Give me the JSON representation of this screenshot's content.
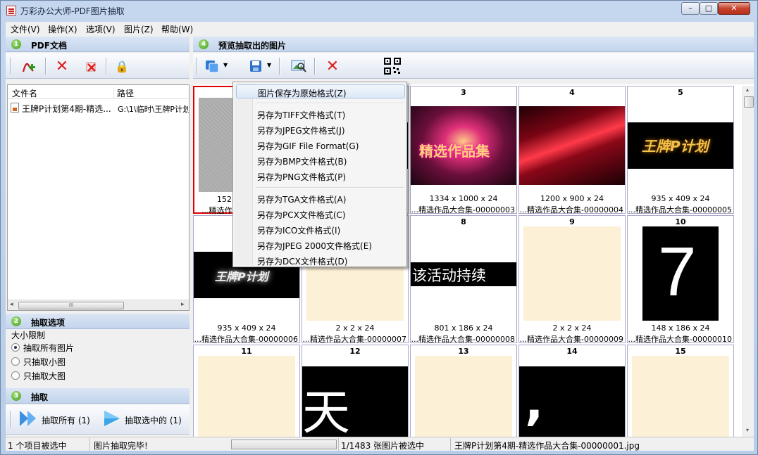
{
  "window": {
    "title": "万彩办公大师-PDF图片抽取",
    "min": "–",
    "max": "□",
    "close": "✕"
  },
  "menu": [
    "文件(V)",
    "操作(X)",
    "选项(V)",
    "图片(Z)",
    "帮助(W)"
  ],
  "panels": {
    "pdf_docs": {
      "num": "1",
      "title": "PDF文档"
    },
    "preview": {
      "num": "4",
      "title": "预览抽取出的图片"
    },
    "options": {
      "num": "2",
      "title": "抽取选项"
    },
    "extract": {
      "num": "3",
      "title": "抽取"
    }
  },
  "doc_list": {
    "col_name": "文件名",
    "col_path": "路径",
    "row": {
      "name": "王牌P计划第4期-精选...",
      "path": "G:\\1\\临时\\王牌P计划"
    }
  },
  "options": {
    "size_label": "大小限制",
    "radios": [
      {
        "label": "抽取所有图片",
        "checked": true
      },
      {
        "label": "只抽取小图",
        "checked": false
      },
      {
        "label": "只抽取大图",
        "checked": false
      }
    ]
  },
  "extract_buttons": {
    "all": "抽取所有 (1)",
    "selected": "抽取选中的 (1)"
  },
  "context_menu": {
    "items": [
      {
        "label": "图片保存为原始格式(Z)",
        "group": 0
      },
      {
        "label": "另存为TIFF文件格式(T)",
        "group": 1
      },
      {
        "label": "另存为JPEG文件格式(J)",
        "group": 1
      },
      {
        "label": "另存为GIF File Format(G)",
        "group": 1
      },
      {
        "label": "另存为BMP文件格式(B)",
        "group": 1
      },
      {
        "label": "另存为PNG文件格式(P)",
        "group": 1
      },
      {
        "label": "另存为TGA文件格式(A)",
        "group": 2
      },
      {
        "label": "另存为PCX文件格式(C)",
        "group": 2
      },
      {
        "label": "另存为ICO文件格式(I)",
        "group": 2
      },
      {
        "label": "另存为JPEG 2000文件格式(E)",
        "group": 2
      },
      {
        "label": "另存为DCX文件格式(D)",
        "group": 2
      }
    ]
  },
  "thumbnails": [
    {
      "num": "",
      "dim": "1528",
      "file": "...精选作品",
      "kind": "gray"
    },
    {
      "num": "",
      "dim": "",
      "file": "",
      "kind": "hidden"
    },
    {
      "num": "3",
      "dim": "1334 x 1000 x 24",
      "file": "...精选作品大合集-00000003",
      "kind": "red-burst",
      "text": "精选作品集"
    },
    {
      "num": "4",
      "dim": "1200 x 900 x 24",
      "file": "...精选作品大合集-00000004",
      "kind": "red-streak"
    },
    {
      "num": "5",
      "dim": "935 x 409 x 24",
      "file": "...精选作品大合集-00000005",
      "kind": "logo-gold",
      "text": "王牌P计划"
    },
    {
      "num": "",
      "dim": "935 x 409 x 24",
      "file": "...精选作品大合集-00000006",
      "kind": "logo-white",
      "text": "王牌P计划"
    },
    {
      "num": "",
      "dim": "2 x 2 x 24",
      "file": "...精选作品大合集-00000007",
      "kind": "cream"
    },
    {
      "num": "8",
      "dim": "801 x 186 x 24",
      "file": "...精选作品大合集-00000008",
      "kind": "text-black",
      "text": "该活动持续"
    },
    {
      "num": "9",
      "dim": "2 x 2 x 24",
      "file": "...精选作品大合集-00000009",
      "kind": "cream"
    },
    {
      "num": "10",
      "dim": "148 x 186 x 24",
      "file": "...精选作品大合集-00000010",
      "kind": "digit",
      "text": "7"
    },
    {
      "num": "11",
      "dim": "",
      "file": "",
      "kind": "cream"
    },
    {
      "num": "12",
      "dim": "",
      "file": "",
      "kind": "big-char",
      "text": "天"
    },
    {
      "num": "13",
      "dim": "",
      "file": "",
      "kind": "cream"
    },
    {
      "num": "14",
      "dim": "",
      "file": "",
      "kind": "comma",
      "text": ","
    },
    {
      "num": "15",
      "dim": "",
      "file": "",
      "kind": "cream"
    }
  ],
  "status": {
    "selected_items": "1 个项目被选中",
    "message": "图片抽取完毕!",
    "count": "1/1483 张图片被选中",
    "file": "王牌P计划第4期-精选作品大合集-00000001.jpg"
  },
  "colors": {
    "accent_red": "#e00000",
    "cream": "#fcf0d6",
    "header_blue": "#c3d4ec"
  }
}
